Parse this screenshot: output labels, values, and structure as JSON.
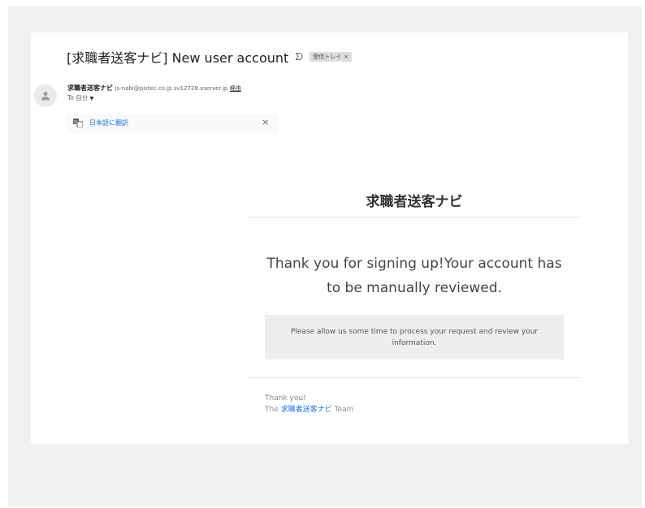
{
  "email": {
    "subject": "[求職者送客ナビ] New user account",
    "label_chip": "受信トレイ",
    "label_close": "×",
    "sender": {
      "name": "求職者送客ナビ",
      "email": "js-nabi@pistec.co.jp sv12728.xserver.jp",
      "via": "経由"
    },
    "to_label": "To 自分",
    "translate": {
      "link": "日本語に翻訳",
      "close": "×"
    }
  },
  "body": {
    "brand": "求職者送客ナビ",
    "headline_line1": "Thank you for signing up!Your account has",
    "headline_line2": "to be manually reviewed.",
    "notice": "Please allow us some time to process your request and review your information.",
    "thanks": "Thank you!",
    "team_prefix": "The",
    "team_brand": "求職者送客ナビ",
    "team_suffix": "Team"
  }
}
